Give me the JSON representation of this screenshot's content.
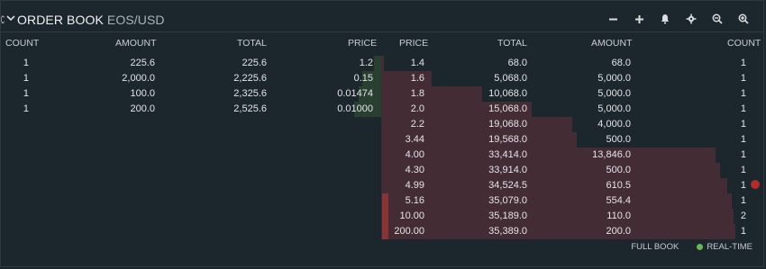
{
  "header": {
    "left_edge_glyph": "C",
    "title": "ORDER BOOK",
    "symbol": "EOS/USD",
    "icons": [
      "minus-icon",
      "plus-icon",
      "bell-icon",
      "gear-icon",
      "zoom-out-icon",
      "zoom-in-icon"
    ]
  },
  "bids": {
    "headers": [
      "COUNT",
      "AMOUNT",
      "TOTAL",
      "PRICE"
    ],
    "rows": [
      {
        "count": "1",
        "amount": "225.6",
        "total": "225.6",
        "price": "1.2",
        "depth": 0.02
      },
      {
        "count": "1",
        "amount": "2,000.0",
        "total": "2,225.6",
        "price": "0.15",
        "depth": 0.05
      },
      {
        "count": "1",
        "amount": "100.0",
        "total": "2,325.6",
        "price": "0.01474",
        "depth": 0.06
      },
      {
        "count": "1",
        "amount": "200.0",
        "total": "2,525.6",
        "price": "0.01000",
        "depth": 0.07
      }
    ]
  },
  "asks": {
    "headers": [
      "PRICE",
      "TOTAL",
      "AMOUNT",
      "COUNT"
    ],
    "rows": [
      {
        "price": "1.4",
        "total": "68.0",
        "amount": "68.0",
        "count": "1",
        "depth": 0.002
      },
      {
        "price": "1.6",
        "total": "5,068.0",
        "amount": "5,000.0",
        "count": "1",
        "depth": 0.143
      },
      {
        "price": "1.8",
        "total": "10,068.0",
        "amount": "5,000.0",
        "count": "1",
        "depth": 0.284
      },
      {
        "price": "2.0",
        "total": "15,068.0",
        "amount": "5,000.0",
        "count": "1",
        "depth": 0.426
      },
      {
        "price": "2.2",
        "total": "19,068.0",
        "amount": "4,000.0",
        "count": "1",
        "depth": 0.539
      },
      {
        "price": "3.44",
        "total": "19,568.0",
        "amount": "500.0",
        "count": "1",
        "depth": 0.553
      },
      {
        "price": "4.00",
        "total": "33,414.0",
        "amount": "13,846.0",
        "count": "1",
        "depth": 0.944
      },
      {
        "price": "4.30",
        "total": "33,914.0",
        "amount": "500.0",
        "count": "1",
        "depth": 0.958
      },
      {
        "price": "4.99",
        "total": "34,524.5",
        "amount": "610.5",
        "count": "1",
        "depth": 0.976
      },
      {
        "price": "5.16",
        "total": "35,079.0",
        "amount": "554.4",
        "count": "1",
        "depth": 0.991
      },
      {
        "price": "10.00",
        "total": "35,189.0",
        "amount": "110.0",
        "count": "2",
        "depth": 0.994
      },
      {
        "price": "200.00",
        "total": "35,389.0",
        "amount": "200.0",
        "count": "1",
        "depth": 1.0
      }
    ]
  },
  "footer": {
    "full_book": "FULL BOOK",
    "realtime": "REAL-TIME"
  },
  "colors": {
    "bid_bar": "#2f4a33",
    "ask_bar": "#4a2d35",
    "accent": "#8b3236",
    "live": "#6eb653"
  }
}
